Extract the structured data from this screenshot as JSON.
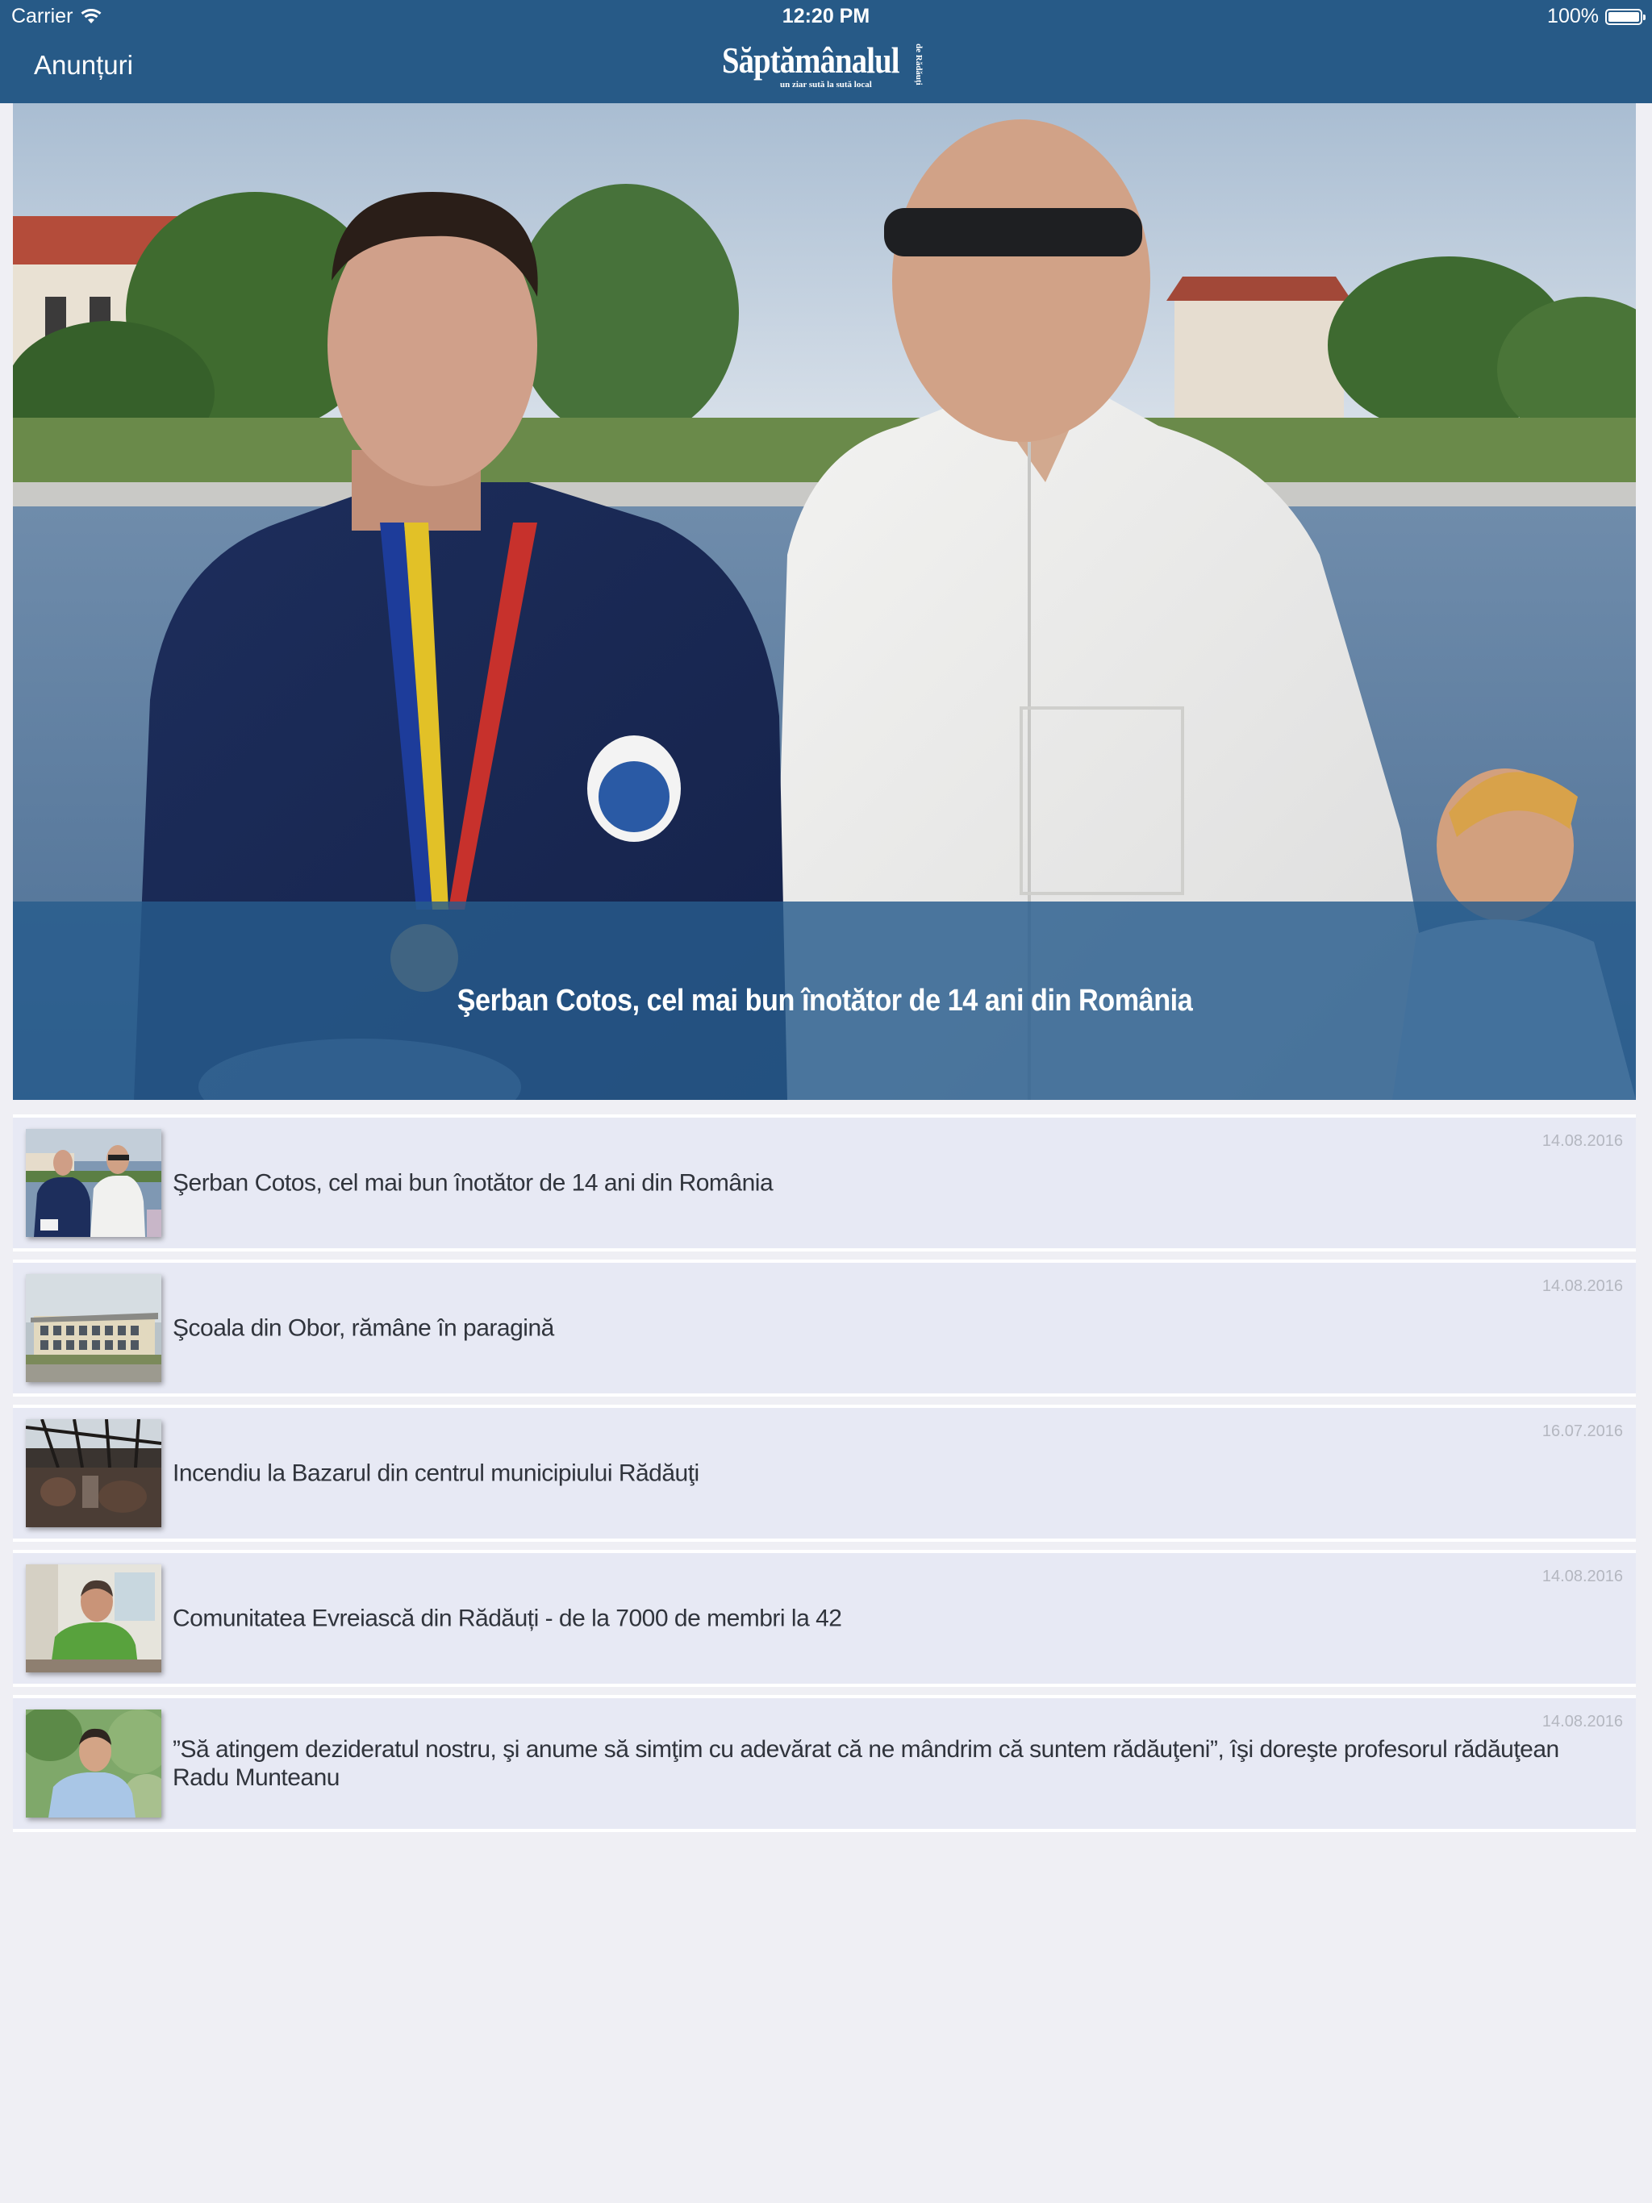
{
  "status_bar": {
    "carrier": "Carrier",
    "time": "12:20 PM",
    "battery": "100%",
    "wifi_icon": "wifi-icon",
    "battery_icon": "battery-icon"
  },
  "nav": {
    "back_label": "Anunțuri",
    "logo_title": "Săptămânalul",
    "logo_tagline": "un ziar sută la sută local",
    "logo_side": "de Rădăuți"
  },
  "hero": {
    "title": "Şerban Cotos, cel mai bun înotător de 14 ani din România"
  },
  "news": [
    {
      "date": "14.08.2016",
      "title": "Şerban Cotos, cel mai bun înotător de 14 ani din România",
      "thumb": "swimmer-photo"
    },
    {
      "date": "14.08.2016",
      "title": "Şcoala din Obor, rămâne în paragină",
      "thumb": "school-building-photo"
    },
    {
      "date": "16.07.2016",
      "title": "Incendiu la Bazarul din centrul municipiului Rădăuţi",
      "thumb": "burned-bazaar-photo"
    },
    {
      "date": "14.08.2016",
      "title": "Comunitatea Evreiască din Rădăuți - de la 7000 de membri la 42",
      "thumb": "man-green-shirt-photo"
    },
    {
      "date": "14.08.2016",
      "title": "”Să atingem dezideratul nostru, şi anume să simţim cu adevărat că ne mândrim că suntem rădăuţeni”,  îşi doreşte profesorul rădăuţean Radu Munteanu",
      "thumb": "man-portrait-photo"
    }
  ],
  "colors": {
    "header": "#275a87",
    "background": "#efeff4",
    "row": "#e7e9f4",
    "caption_overlay": "#275c8c"
  }
}
